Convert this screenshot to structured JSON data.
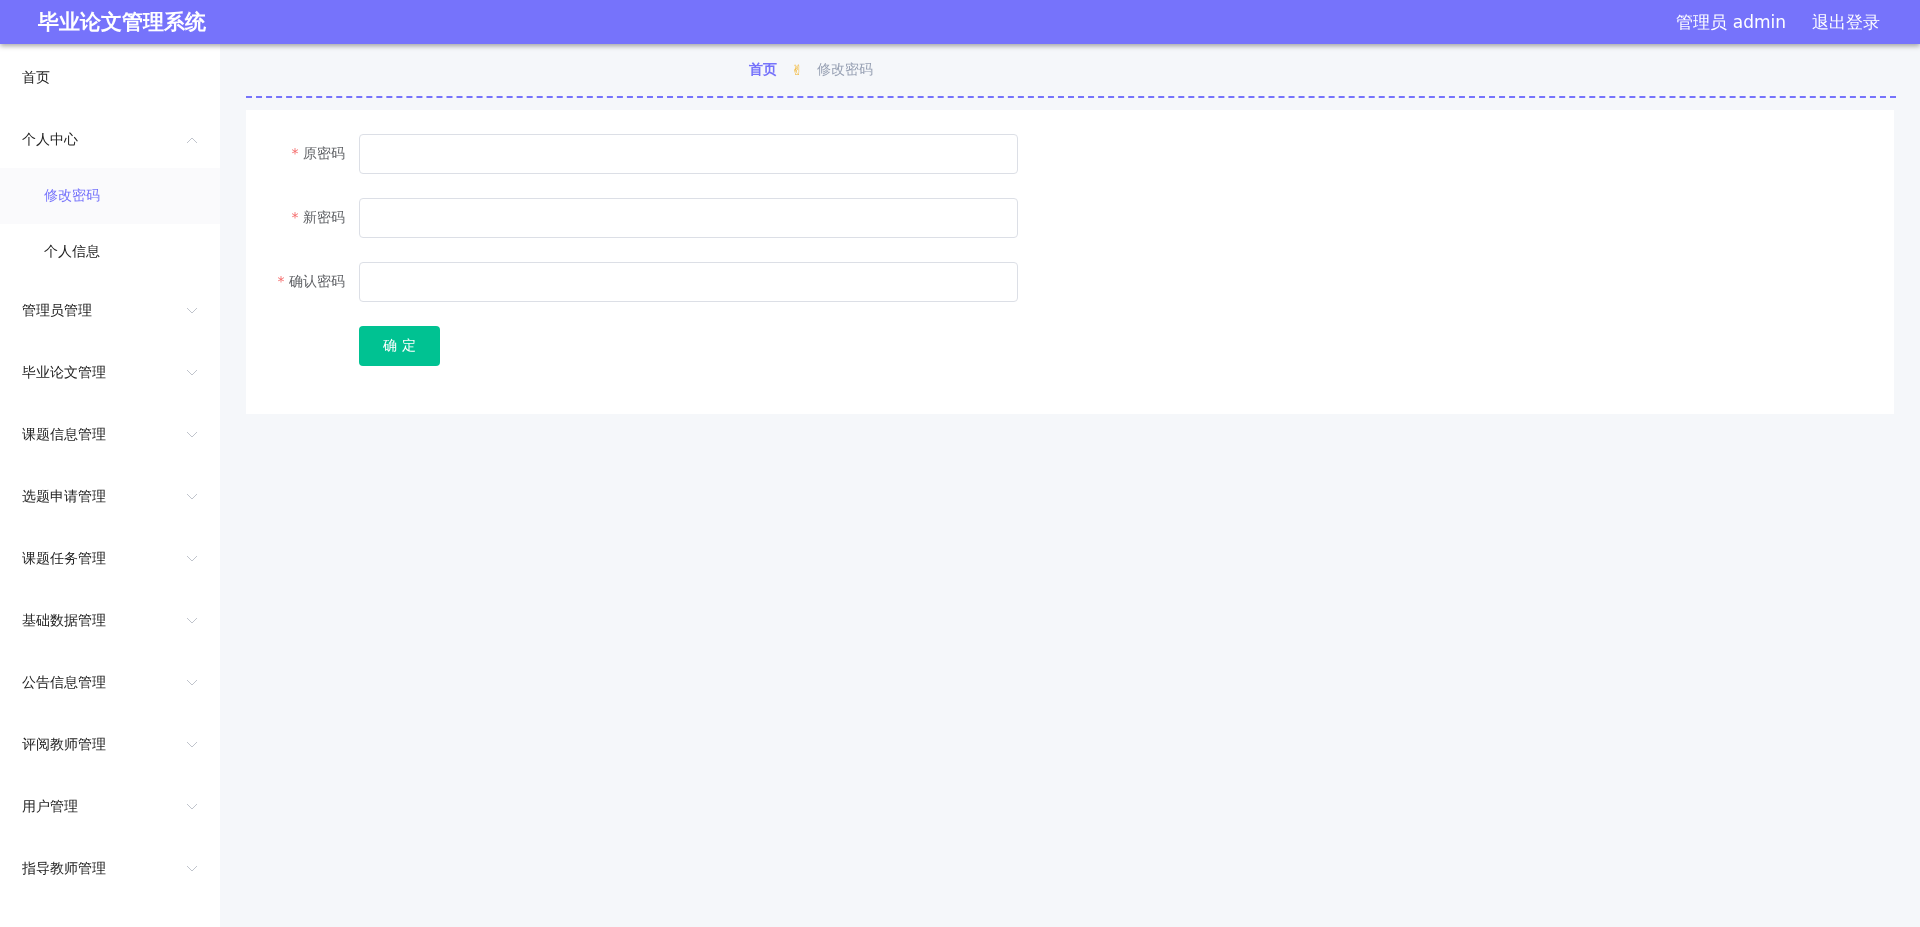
{
  "header": {
    "title": "毕业论文管理系统",
    "user": "管理员 admin",
    "logout": "退出登录"
  },
  "sidebar": {
    "items": [
      {
        "label": "首页",
        "kind": "link",
        "selected": false
      },
      {
        "label": "个人中心",
        "kind": "group",
        "expanded": true,
        "selected": false,
        "children": [
          {
            "label": "修改密码",
            "selected": true
          },
          {
            "label": "个人信息",
            "selected": false
          }
        ]
      },
      {
        "label": "管理员管理",
        "kind": "group",
        "expanded": false,
        "selected": false
      },
      {
        "label": "毕业论文管理",
        "kind": "group",
        "expanded": false,
        "selected": false
      },
      {
        "label": "课题信息管理",
        "kind": "group",
        "expanded": false,
        "selected": false
      },
      {
        "label": "选题申请管理",
        "kind": "group",
        "expanded": false,
        "selected": false
      },
      {
        "label": "课题任务管理",
        "kind": "group",
        "expanded": false,
        "selected": false
      },
      {
        "label": "基础数据管理",
        "kind": "group",
        "expanded": false,
        "selected": false
      },
      {
        "label": "公告信息管理",
        "kind": "group",
        "expanded": false,
        "selected": false
      },
      {
        "label": "评阅教师管理",
        "kind": "group",
        "expanded": false,
        "selected": false
      },
      {
        "label": "用户管理",
        "kind": "group",
        "expanded": false,
        "selected": false
      },
      {
        "label": "指导教师管理",
        "kind": "group",
        "expanded": false,
        "selected": false
      }
    ]
  },
  "breadcrumb": {
    "items": [
      "首页",
      "修改密码"
    ],
    "separator": "✌"
  },
  "form": {
    "fields": [
      {
        "label": "原密码",
        "required": true
      },
      {
        "label": "新密码",
        "required": true
      },
      {
        "label": "确认密码",
        "required": true
      }
    ],
    "required_mark": "*",
    "submit": "确 定"
  }
}
